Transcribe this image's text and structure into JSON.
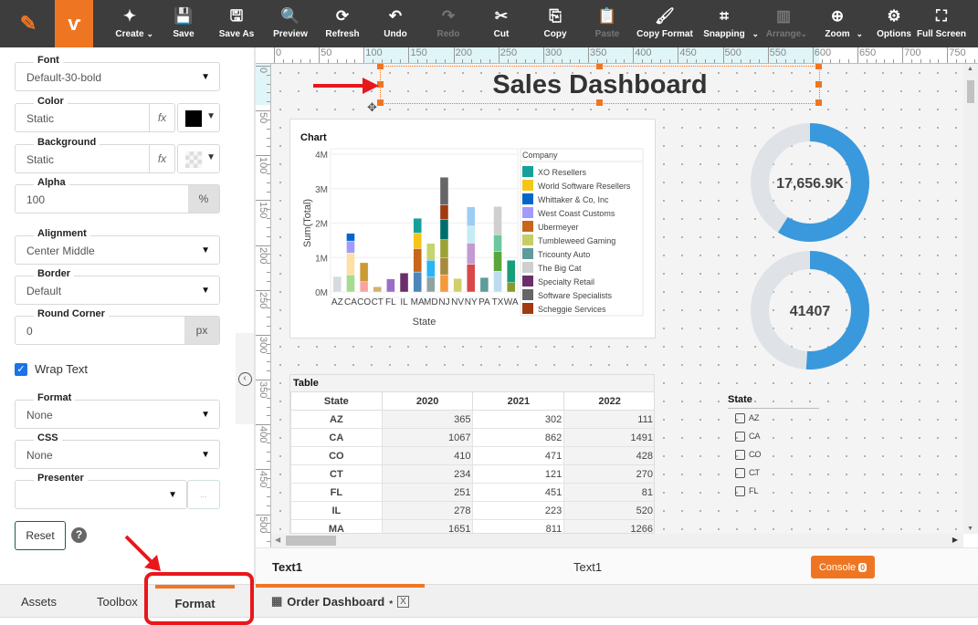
{
  "colors": {
    "toolbar": "#3d3d3d",
    "accent": "#ee7623",
    "gauge": "#3a99dc",
    "gauge_bg": "#dfe2e6",
    "annotation": "#e8171b"
  },
  "toolbar": {
    "items": [
      {
        "label": "Create",
        "icon": "sparkle-icon",
        "caret": true
      },
      {
        "label": "Save",
        "icon": "save-icon"
      },
      {
        "label": "Save As",
        "icon": "save-as-icon"
      },
      {
        "label": "Preview",
        "icon": "preview-icon"
      },
      {
        "label": "Refresh",
        "icon": "refresh-icon"
      },
      {
        "label": "Undo",
        "icon": "undo-icon"
      },
      {
        "label": "Redo",
        "icon": "redo-icon",
        "disabled": true
      },
      {
        "label": "Cut",
        "icon": "scissors-icon"
      },
      {
        "label": "Copy",
        "icon": "copy-icon"
      },
      {
        "label": "Paste",
        "icon": "paste-icon",
        "disabled": true
      },
      {
        "label": "Copy Format",
        "icon": "paint-roller-icon"
      },
      {
        "label": "Snapping",
        "icon": "snapping-icon",
        "caret": true
      },
      {
        "label": "Arrange",
        "icon": "arrange-icon",
        "caret": true,
        "disabled": true
      },
      {
        "label": "Zoom",
        "icon": "zoom-in-icon",
        "caret": true
      },
      {
        "label": "Options",
        "icon": "gear-icon"
      },
      {
        "label": "Full Screen",
        "icon": "fullscreen-icon"
      }
    ]
  },
  "format_panel": {
    "font": {
      "label": "Font",
      "value": "Default-30-bold"
    },
    "color": {
      "label": "Color",
      "value": "Static",
      "swatch": "#000000"
    },
    "background": {
      "label": "Background",
      "value": "Static"
    },
    "alpha": {
      "label": "Alpha",
      "value": "100",
      "unit": "%"
    },
    "alignment": {
      "label": "Alignment",
      "value": "Center Middle"
    },
    "border": {
      "label": "Border",
      "value": "Default"
    },
    "round_corner": {
      "label": "Round Corner",
      "value": "0",
      "unit": "px"
    },
    "wrap_text": {
      "label": "Wrap Text",
      "checked": true
    },
    "format": {
      "label": "Format",
      "value": "None"
    },
    "css": {
      "label": "CSS",
      "value": "None"
    },
    "presenter": {
      "label": "Presenter",
      "value": "",
      "more": "..."
    },
    "reset_label": "Reset",
    "help": "?"
  },
  "canvas": {
    "title": "Sales Dashboard",
    "gauges": [
      {
        "value": "17,656.9K",
        "fraction": 0.59
      },
      {
        "value": "41407",
        "fraction": 0.51
      }
    ],
    "table": {
      "title": "Table",
      "columns": [
        "State",
        "2020",
        "2021",
        "2022"
      ],
      "rows": [
        [
          "AZ",
          "365",
          "302",
          "111"
        ],
        [
          "CA",
          "1067",
          "862",
          "1491"
        ],
        [
          "CO",
          "410",
          "471",
          "428"
        ],
        [
          "CT",
          "234",
          "121",
          "270"
        ],
        [
          "FL",
          "251",
          "451",
          "81"
        ],
        [
          "IL",
          "278",
          "223",
          "520"
        ],
        [
          "MA",
          "1651",
          "811",
          "1266"
        ]
      ]
    },
    "state_filter": {
      "title": "State",
      "options": [
        "AZ",
        "CA",
        "CO",
        "CT",
        "FL"
      ]
    }
  },
  "chart_data": {
    "type": "bar",
    "stacked": true,
    "title": "Chart",
    "xlabel": "State",
    "ylabel": "Sum(Total)",
    "ylim": [
      0,
      4000000
    ],
    "yticks": [
      "0M",
      "1M",
      "2M",
      "3M",
      "4M"
    ],
    "grid": true,
    "legend_position": "right",
    "legend_title": "Company",
    "legend": [
      {
        "name": "XO Resellers",
        "color": "#17a09a"
      },
      {
        "name": "World Software Resellers",
        "color": "#f5c518"
      },
      {
        "name": "Whittaker & Co, Inc",
        "color": "#0066cc"
      },
      {
        "name": "West Coast Customs",
        "color": "#a29bfe"
      },
      {
        "name": "Ubermeyer",
        "color": "#c8651b"
      },
      {
        "name": "Tumbleweed Gaming",
        "color": "#c6cd62"
      },
      {
        "name": "Tricounty Auto",
        "color": "#5f9b9b"
      },
      {
        "name": "The Big Cat",
        "color": "#cfcfcf"
      },
      {
        "name": "Specialty Retail",
        "color": "#6a2f6a"
      },
      {
        "name": "Software Specialists",
        "color": "#666666"
      },
      {
        "name": "Scheggie Services",
        "color": "#a03a10"
      }
    ],
    "categories": [
      "AZ",
      "CA",
      "CO",
      "CT",
      "FL",
      "IL",
      "MA",
      "MD",
      "NJ",
      "NV",
      "NY",
      "PA",
      "TX",
      "WA"
    ],
    "stacks": [
      [
        {
          "v": 450000,
          "c": "#d5dbe0"
        }
      ],
      [
        {
          "v": 500000,
          "c": "#a6dc8f"
        },
        {
          "v": 630000,
          "c": "#fde0a6"
        },
        {
          "v": 350000,
          "c": "#a29bfe"
        },
        {
          "v": 220000,
          "c": "#0066cc"
        }
      ],
      [
        {
          "v": 300000,
          "c": "#f8a5a0"
        },
        {
          "v": 550000,
          "c": "#cc9a33"
        }
      ],
      [
        {
          "v": 150000,
          "c": "#d4b06a"
        }
      ],
      [
        {
          "v": 380000,
          "c": "#9b6dc6"
        }
      ],
      [
        {
          "v": 550000,
          "c": "#6a2f6a"
        }
      ],
      [
        {
          "v": 580000,
          "c": "#4c87b9"
        },
        {
          "v": 680000,
          "c": "#c8651b"
        },
        {
          "v": 450000,
          "c": "#f5c518"
        },
        {
          "v": 430000,
          "c": "#17a09a"
        }
      ],
      [
        {
          "v": 430000,
          "c": "#8fa3a3"
        },
        {
          "v": 490000,
          "c": "#28b5f5"
        },
        {
          "v": 490000,
          "c": "#c6d46e"
        }
      ],
      [
        {
          "v": 500000,
          "c": "#f59a3c"
        },
        {
          "v": 500000,
          "c": "#a88a3e"
        },
        {
          "v": 520000,
          "c": "#9aa235"
        },
        {
          "v": 580000,
          "c": "#006d6d"
        },
        {
          "v": 430000,
          "c": "#a03a10"
        },
        {
          "v": 800000,
          "c": "#666666"
        }
      ],
      [
        {
          "v": 390000,
          "c": "#cfd06a"
        }
      ],
      [
        {
          "v": 800000,
          "c": "#d94848"
        },
        {
          "v": 620000,
          "c": "#c39bd3"
        },
        {
          "v": 490000,
          "c": "#c5ecf3"
        },
        {
          "v": 560000,
          "c": "#9dccf5"
        }
      ],
      [
        {
          "v": 420000,
          "c": "#5f9b9b"
        }
      ],
      [
        {
          "v": 600000,
          "c": "#bcdcf0"
        },
        {
          "v": 580000,
          "c": "#5ba63a"
        },
        {
          "v": 480000,
          "c": "#6cc79e"
        },
        {
          "v": 820000,
          "c": "#cfcfcf"
        }
      ],
      [
        {
          "v": 270000,
          "c": "#8a9a2a"
        },
        {
          "v": 650000,
          "c": "#189e76"
        }
      ]
    ]
  },
  "status": {
    "selected_left": "Text1",
    "selected_center": "Text1",
    "console_label": "Console",
    "console_count": "0"
  },
  "bottom_tabs": {
    "assets": "Assets",
    "toolbox": "Toolbox",
    "format": "Format",
    "doc_tab": "Order Dashboard",
    "doc_modified": "*",
    "close": "X"
  }
}
